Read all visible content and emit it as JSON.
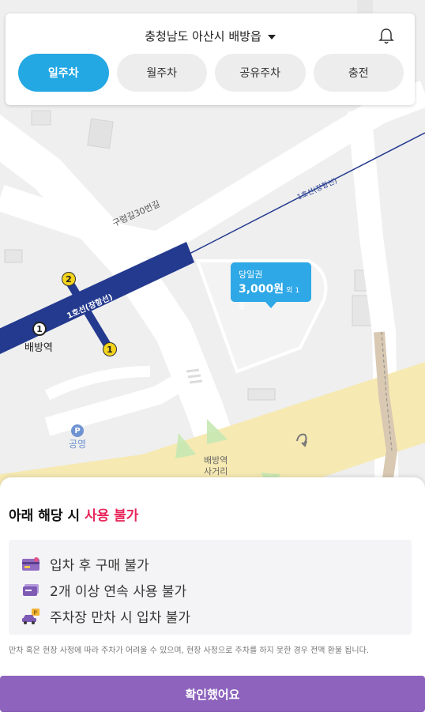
{
  "header": {
    "location": "충청남도 아산시 배방읍",
    "tabs": [
      {
        "label": "일주차",
        "active": true
      },
      {
        "label": "월주차",
        "active": false
      },
      {
        "label": "공유주차",
        "active": false
      },
      {
        "label": "충전",
        "active": false
      }
    ]
  },
  "map": {
    "road_label": "구령길30번길",
    "rail_label": "1호선(장항선)",
    "rail_label_2": "1호선(장항선)",
    "station": {
      "name": "배방역",
      "line_number": "1"
    },
    "exits": [
      "2",
      "1"
    ],
    "parking": {
      "icon": "P",
      "label": "공영"
    },
    "intersection": {
      "line1": "배방역",
      "line2": "사거리"
    },
    "price_pin": {
      "title": "당일권",
      "price": "3,000원",
      "note": "외 1종"
    }
  },
  "sheet": {
    "title_prefix": "아래 해당 시 ",
    "title_highlight": "사용 불가",
    "rules": [
      {
        "icon": "card-icon",
        "text": "입차 후 구매 불가"
      },
      {
        "icon": "ticket-icon",
        "text": "2개 이상 연속 사용 불가"
      },
      {
        "icon": "full-parking-car-icon",
        "text": "주차장 만차 시 입차 불가"
      }
    ],
    "disclaimer": "만차 혹은 현장 사정에 따라 주차가 어려울 수 있으며, 현장 사정으로 주차를 하지 못한 경우 전액 환불 됩니다.",
    "confirm_label": "확인했어요"
  },
  "colors": {
    "accent": "#23a8e4",
    "highlight": "#e8265a",
    "confirm": "#8d63bd",
    "rail": "#243a8f"
  }
}
